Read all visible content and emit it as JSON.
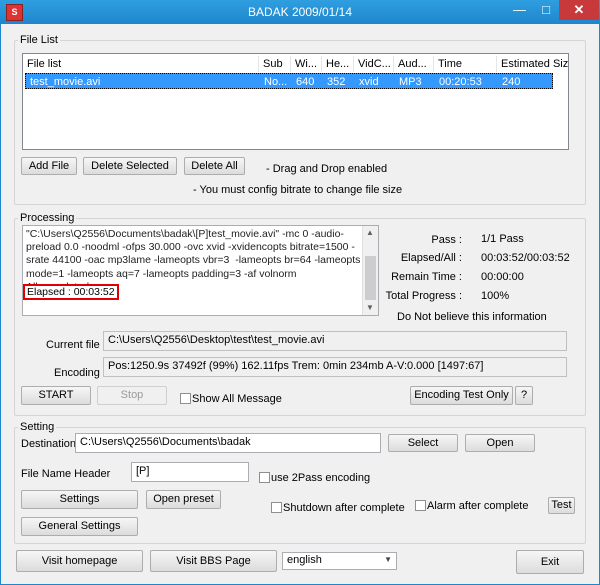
{
  "window": {
    "title": "BADAK 2009/01/14",
    "app_icon": "S",
    "minimize": "—",
    "maximize": "□",
    "close": "✕"
  },
  "file_list_group": {
    "label": "File List",
    "columns": [
      "File list",
      "Sub",
      "Wi...",
      "He...",
      "VidC...",
      "Aud...",
      "Time",
      "Estimated Siz..."
    ],
    "rows": [
      [
        "test_movie.avi",
        "No...",
        "640",
        "352",
        "xvid",
        "MP3",
        "00:20:53",
        "240"
      ]
    ],
    "add_file": "Add File",
    "delete_selected": "Delete Selected",
    "delete_all": "Delete All",
    "hint_drag": "- Drag and Drop enabled",
    "hint_bitrate": "- You must config bitrate to change file size"
  },
  "processing": {
    "label": "Processing",
    "log": "\"C:\\Users\\Q2556\\Documents\\badak\\[P]test_movie.avi\" -mc 0 -audio-preload 0.0 -noodml -ofps 30.000 -ovc xvid -xvidencopts bitrate=1500 -srate 44100 -oac mp3lame -lameopts vbr=3  -lameopts br=64 -lameopts mode=1 -lameopts aq=7 -lameopts padding=3 -af volnorm\nAll completed",
    "elapsed_line": "Elapsed : 00:03:52",
    "stats": {
      "pass_label": "Pass :",
      "pass_value": "1/1 Pass",
      "elapsed_label": "Elapsed/All :",
      "elapsed_value": "00:03:52/00:03:52",
      "remain_label": "Remain Time :",
      "remain_value": "00:00:00",
      "total_label": "Total Progress :",
      "total_value": "100%",
      "notice": "Do Not believe this information"
    },
    "current_file_label": "Current file :",
    "current_file": "C:\\Users\\Q2556\\Desktop\\test\\test_movie.avi",
    "encoding_label": "Encoding",
    "encoding_status": "Pos:1250.9s  37492f (99%) 162.11fps Trem:    0min 234mb  A-V:0.000 [1497:67]",
    "start": "START",
    "stop": "Stop",
    "show_all_message": "Show All Message",
    "encoding_test_only": "Encoding Test Only",
    "help": "?"
  },
  "setting": {
    "label": "Setting",
    "destination_label": "Destination",
    "destination": "C:\\Users\\Q2556\\Documents\\badak",
    "select": "Select",
    "open": "Open",
    "file_name_header_label": "File Name Header",
    "file_name_header": "[P]",
    "use_2pass": "use 2Pass encoding",
    "settings": "Settings",
    "open_preset": "Open preset",
    "shutdown_after": "Shutdown after complete",
    "alarm_after": "Alarm after complete",
    "test": "Test",
    "general_settings": "General Settings"
  },
  "footer": {
    "visit_homepage": "Visit homepage",
    "visit_bbs": "Visit BBS Page",
    "language": "english",
    "exit": "Exit"
  },
  "colors": {
    "titlebar": "#1e86cc",
    "selection": "#3399ff",
    "highlight_box": "#e00000",
    "close_button": "#c7393a"
  }
}
